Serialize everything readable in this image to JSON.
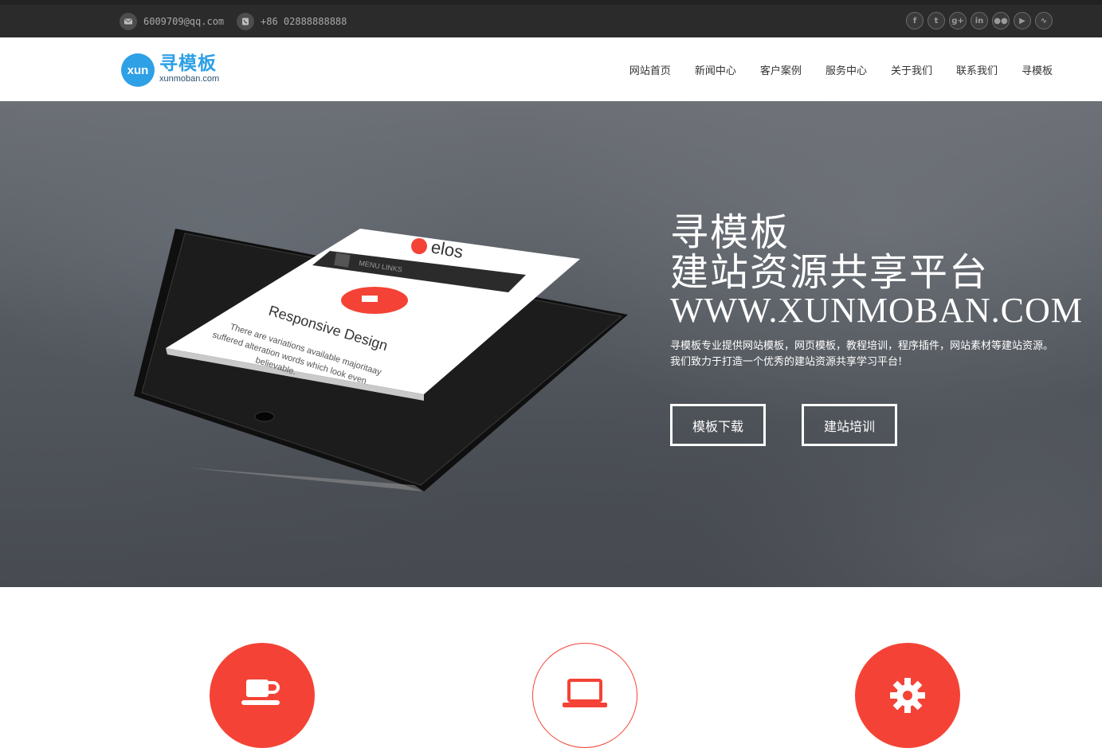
{
  "topbar": {
    "email": "6009709@qq.com",
    "phone": "+86 02888888888",
    "socials": [
      "facebook",
      "twitter",
      "google-plus",
      "linkedin",
      "flickr",
      "youtube",
      "rss"
    ],
    "social_glyphs": [
      "f",
      "t",
      "g+",
      "in",
      "●●",
      "▶",
      "∿"
    ]
  },
  "header": {
    "logo_badge": "xun",
    "logo_title": "寻模板",
    "logo_domain": "xunmoban.com",
    "nav": [
      "网站首页",
      "新闻中心",
      "客户案例",
      "服务中心",
      "关于我们",
      "联系我们",
      "寻模板"
    ]
  },
  "hero": {
    "title_line1": "寻模板",
    "title_line2": "建站资源共享平台",
    "domain": "WWW.XUNMOBAN.COM",
    "desc_line1": "寻模板专业提供网站模板，网页模板，教程培训，程序插件，网站素材等建站资源。",
    "desc_line2": "我们致力于打造一个优秀的建站资源共享学习平台!",
    "button1": "模板下载",
    "button2": "建站培训",
    "device": {
      "brand": "elos",
      "menu": "MENU LINKS",
      "heading": "Responsive Design",
      "text1": "There are variations available majoritaay",
      "text2": "suffered alteration words which look even",
      "text3": "believable."
    }
  },
  "features": {
    "icons": [
      "coffee-cup-icon",
      "laptop-icon",
      "gear-icon"
    ]
  },
  "colors": {
    "accent": "#f44336",
    "logo_blue": "#2ea0e6",
    "topbar": "#2b2b2b"
  }
}
